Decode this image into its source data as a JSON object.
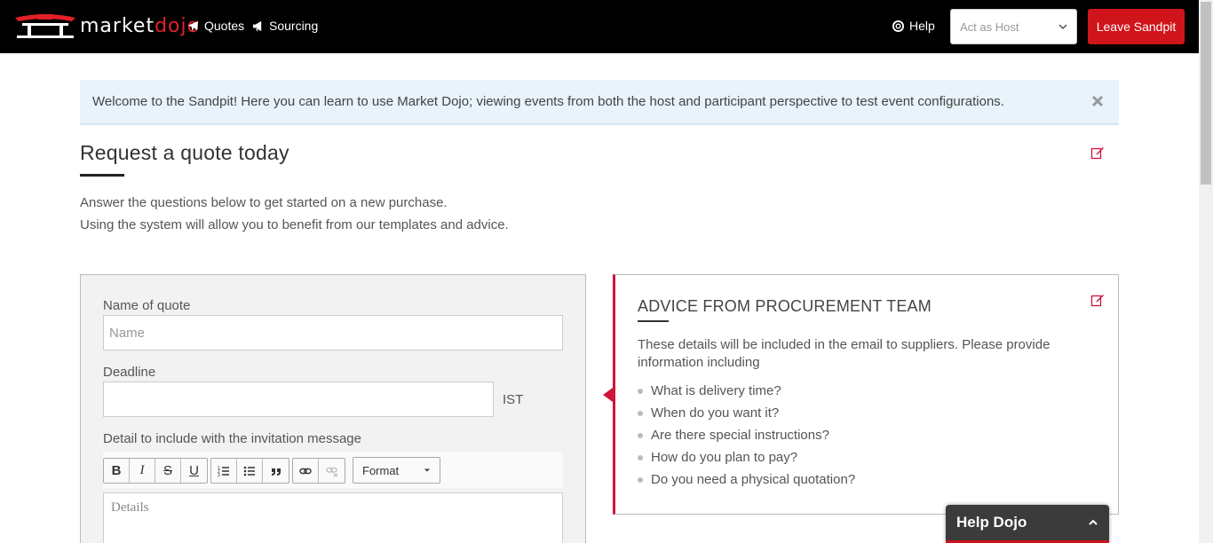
{
  "brand": {
    "logo_text_1": "market",
    "logo_text_2": "dojo"
  },
  "nav": {
    "quotes": "Quotes",
    "sourcing": "Sourcing",
    "help": "Help",
    "act_as_placeholder": "Act as Host",
    "leave_button": "Leave Sandpit"
  },
  "banner": {
    "message": "Welcome to the Sandpit! Here you can learn to use Market Dojo; viewing events from both the host and participant perspective to test event configurations."
  },
  "page": {
    "title": "Request a quote today",
    "intro_1": "Answer the questions below to get started on a new purchase.",
    "intro_2": "Using the system will allow you to benefit from our templates and advice."
  },
  "form": {
    "name_label": "Name of quote",
    "name_placeholder": "Name",
    "deadline_label": "Deadline",
    "deadline_value": "",
    "timezone": "IST",
    "detail_label": "Detail to include with the invitation message",
    "format_label": "Format",
    "details_placeholder": "Details"
  },
  "advice": {
    "title": "ADVICE FROM PROCUREMENT TEAM",
    "text": "These details will be included in the email to suppliers. Please provide information including",
    "items": [
      "What is delivery time?",
      "When do you want it?",
      "Are there special instructions?",
      "How do you plan to pay?",
      "Do you need a physical quotation?"
    ]
  },
  "help_widget": {
    "label": "Help Dojo"
  },
  "colors": {
    "brand_red": "#d0141b",
    "topbar": "#000000",
    "banner_bg": "#e8f3fb"
  }
}
